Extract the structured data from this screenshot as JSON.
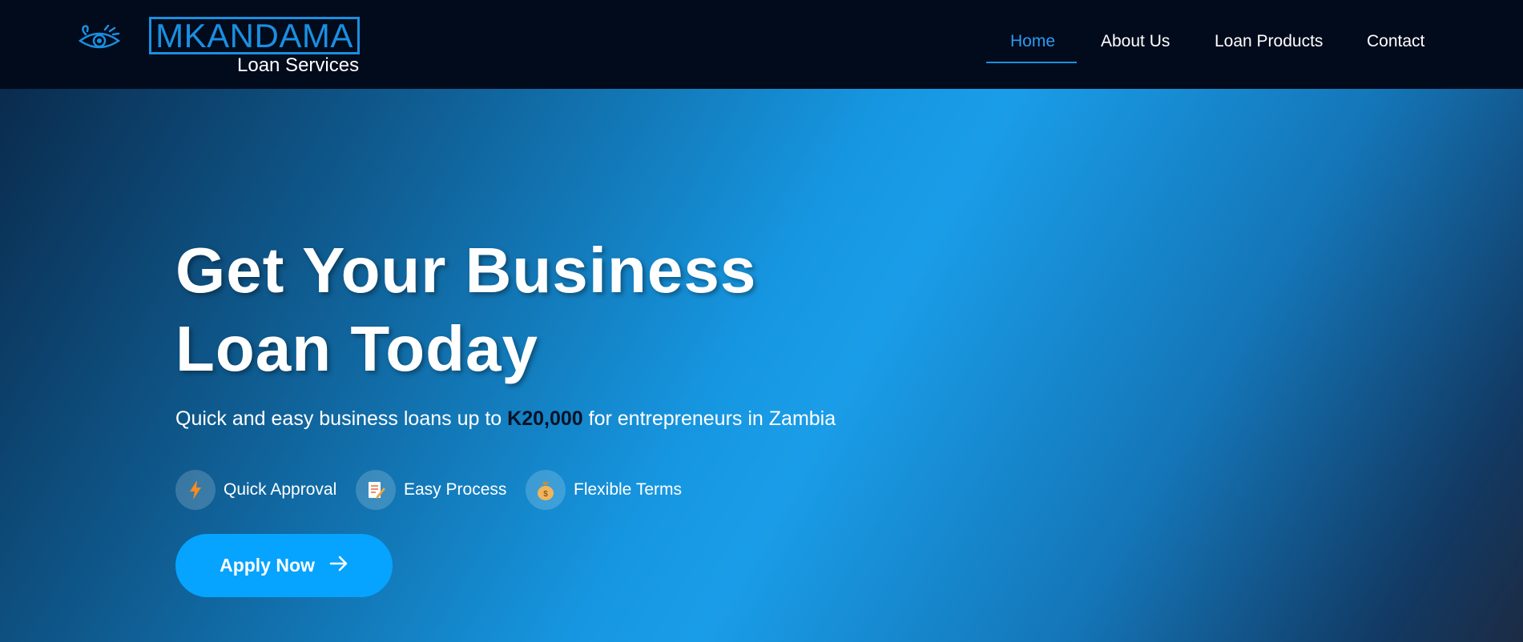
{
  "brand": {
    "name": "MKANDAMA",
    "tagline": "Loan Services",
    "icon": "eye-logo-icon",
    "accent_color": "#1a8fe0"
  },
  "nav": {
    "items": [
      {
        "label": "Home",
        "active": true
      },
      {
        "label": "About Us",
        "active": false
      },
      {
        "label": "Loan Products",
        "active": false
      },
      {
        "label": "Contact",
        "active": false
      }
    ]
  },
  "hero": {
    "title_line1": "Get Your Business",
    "title_line2": "Loan Today",
    "subtitle_prefix": "Quick and easy business loans up to",
    "subtitle_amount": "K20,000",
    "subtitle_suffix": "for entrepreneurs in Zambia",
    "features": [
      {
        "label": "Quick Approval",
        "icon": "lightning-icon"
      },
      {
        "label": "Easy Process",
        "icon": "document-pencil-icon"
      },
      {
        "label": "Flexible Terms",
        "icon": "money-bag-icon"
      }
    ],
    "cta": {
      "label": "Apply Now",
      "icon": "arrow-right-icon",
      "color": "#06a3ff"
    }
  }
}
